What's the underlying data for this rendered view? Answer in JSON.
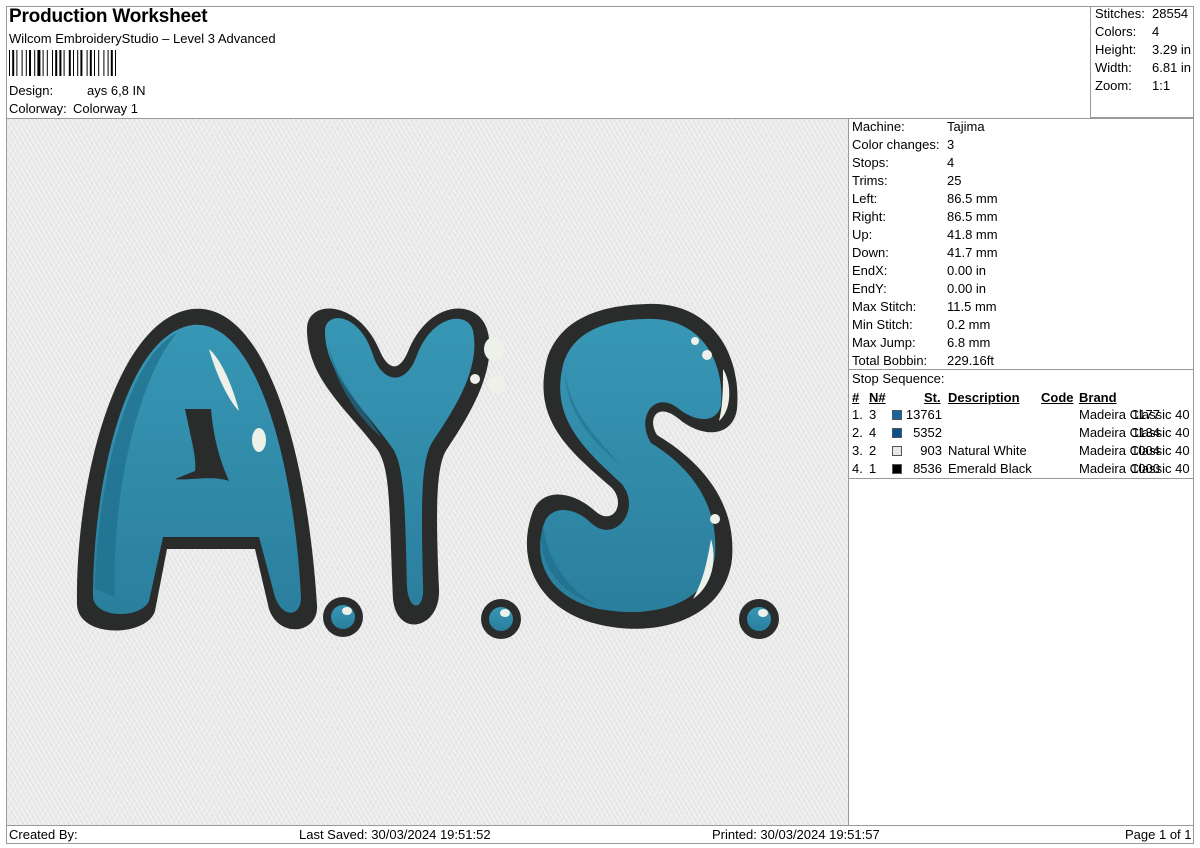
{
  "header": {
    "title": "Production Worksheet",
    "software": "Wilcom EmbroideryStudio – Level 3 Advanced",
    "design_label": "Design:",
    "design_value": "ays 6,8 IN",
    "colorway_label": "Colorway:",
    "colorway_value": "Colorway 1"
  },
  "summary": {
    "stitches_label": "Stitches:",
    "stitches": "28554",
    "colors_label": "Colors:",
    "colors": "4",
    "height_label": "Height:",
    "height": "3.29 in",
    "width_label": "Width:",
    "width": "6.81 in",
    "zoom_label": "Zoom:",
    "zoom": "1:1"
  },
  "machine": [
    {
      "label": "Machine:",
      "value": "Tajima"
    },
    {
      "label": "Color changes:",
      "value": "3"
    },
    {
      "label": "Stops:",
      "value": "4"
    },
    {
      "label": "Trims:",
      "value": "25"
    },
    {
      "label": "Left:",
      "value": "86.5 mm"
    },
    {
      "label": "Right:",
      "value": "86.5 mm"
    },
    {
      "label": "Up:",
      "value": "41.8 mm"
    },
    {
      "label": "Down:",
      "value": "41.7 mm"
    },
    {
      "label": "EndX:",
      "value": "0.00 in"
    },
    {
      "label": "EndY:",
      "value": "0.00 in"
    },
    {
      "label": "Max Stitch:",
      "value": "11.5 mm"
    },
    {
      "label": "Min Stitch:",
      "value": "0.2 mm"
    },
    {
      "label": "Max Jump:",
      "value": "6.8 mm"
    },
    {
      "label": "Total Bobbin:",
      "value": "229.16ft"
    }
  ],
  "stop_sequence": {
    "heading": "Stop Sequence:",
    "columns": {
      "num": "#",
      "n": "N#",
      "st": "St.",
      "description": "Description",
      "code": "Code",
      "brand": "Brand"
    },
    "rows": [
      {
        "num": "1.",
        "n": "3",
        "color": "#1565a0",
        "st": "13761",
        "description": "",
        "code": "1177",
        "brand": "Madeira Classic 40"
      },
      {
        "num": "2.",
        "n": "4",
        "color": "#0e4f8f",
        "st": "5352",
        "description": "",
        "code": "1134",
        "brand": "Madeira Classic 40"
      },
      {
        "num": "3.",
        "n": "2",
        "color": "#e8e8e8",
        "st": "903",
        "description": "Natural White",
        "code": "1004",
        "brand": "Madeira Classic 40"
      },
      {
        "num": "4.",
        "n": "1",
        "color": "#000000",
        "st": "8536",
        "description": "Emerald Black",
        "code": "1000",
        "brand": "Madeira Classic 40"
      }
    ]
  },
  "design_text": "A.Y.S.",
  "colors": {
    "fill_blue": "#2f8aa8",
    "shade_blue": "#1f6f8c",
    "outline": "#2a2c2c",
    "highlight": "#eef0ea",
    "fabric": "#e9e9e9"
  },
  "footer": {
    "created_by": "Created By:",
    "last_saved": "Last Saved: 30/03/2024 19:51:52",
    "printed": "Printed: 30/03/2024 19:51:57",
    "page": "Page 1 of 1"
  }
}
